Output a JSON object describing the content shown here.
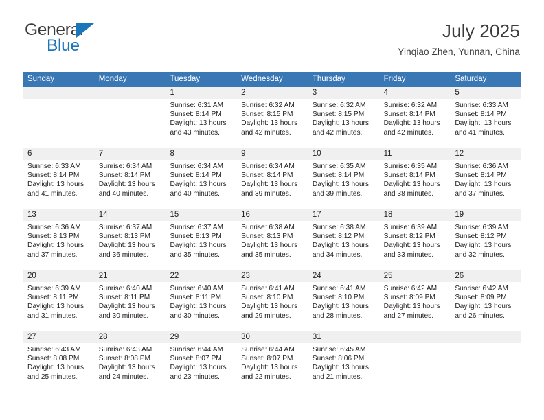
{
  "brand": {
    "name_top": "General",
    "name_bottom": "Blue",
    "color_primary": "#1b75bb",
    "color_text": "#3b3b3b",
    "triangle_icon": "triangle-icon"
  },
  "header": {
    "title": "July 2025",
    "subtitle": "Yinqiao Zhen, Yunnan, China"
  },
  "theme": {
    "header_bg": "#3a77b5",
    "header_text": "#ffffff",
    "daynum_bg": "#f0f0f0",
    "rule": "#3a77b5",
    "body_text": "#231f20"
  },
  "weekdays": [
    "Sunday",
    "Monday",
    "Tuesday",
    "Wednesday",
    "Thursday",
    "Friday",
    "Saturday"
  ],
  "labels": {
    "sunrise_prefix": "Sunrise:",
    "sunset_prefix": "Sunset:",
    "daylight_prefix": "Daylight:"
  },
  "weeks": [
    [
      {
        "day": "",
        "empty": true
      },
      {
        "day": "",
        "empty": true
      },
      {
        "day": "1",
        "sunrise": "Sunrise: 6:31 AM",
        "sunset": "Sunset: 8:14 PM",
        "daylight_l1": "Daylight: 13 hours",
        "daylight_l2": "and 43 minutes."
      },
      {
        "day": "2",
        "sunrise": "Sunrise: 6:32 AM",
        "sunset": "Sunset: 8:15 PM",
        "daylight_l1": "Daylight: 13 hours",
        "daylight_l2": "and 42 minutes."
      },
      {
        "day": "3",
        "sunrise": "Sunrise: 6:32 AM",
        "sunset": "Sunset: 8:15 PM",
        "daylight_l1": "Daylight: 13 hours",
        "daylight_l2": "and 42 minutes."
      },
      {
        "day": "4",
        "sunrise": "Sunrise: 6:32 AM",
        "sunset": "Sunset: 8:14 PM",
        "daylight_l1": "Daylight: 13 hours",
        "daylight_l2": "and 42 minutes."
      },
      {
        "day": "5",
        "sunrise": "Sunrise: 6:33 AM",
        "sunset": "Sunset: 8:14 PM",
        "daylight_l1": "Daylight: 13 hours",
        "daylight_l2": "and 41 minutes."
      }
    ],
    [
      {
        "day": "6",
        "sunrise": "Sunrise: 6:33 AM",
        "sunset": "Sunset: 8:14 PM",
        "daylight_l1": "Daylight: 13 hours",
        "daylight_l2": "and 41 minutes."
      },
      {
        "day": "7",
        "sunrise": "Sunrise: 6:34 AM",
        "sunset": "Sunset: 8:14 PM",
        "daylight_l1": "Daylight: 13 hours",
        "daylight_l2": "and 40 minutes."
      },
      {
        "day": "8",
        "sunrise": "Sunrise: 6:34 AM",
        "sunset": "Sunset: 8:14 PM",
        "daylight_l1": "Daylight: 13 hours",
        "daylight_l2": "and 40 minutes."
      },
      {
        "day": "9",
        "sunrise": "Sunrise: 6:34 AM",
        "sunset": "Sunset: 8:14 PM",
        "daylight_l1": "Daylight: 13 hours",
        "daylight_l2": "and 39 minutes."
      },
      {
        "day": "10",
        "sunrise": "Sunrise: 6:35 AM",
        "sunset": "Sunset: 8:14 PM",
        "daylight_l1": "Daylight: 13 hours",
        "daylight_l2": "and 39 minutes."
      },
      {
        "day": "11",
        "sunrise": "Sunrise: 6:35 AM",
        "sunset": "Sunset: 8:14 PM",
        "daylight_l1": "Daylight: 13 hours",
        "daylight_l2": "and 38 minutes."
      },
      {
        "day": "12",
        "sunrise": "Sunrise: 6:36 AM",
        "sunset": "Sunset: 8:14 PM",
        "daylight_l1": "Daylight: 13 hours",
        "daylight_l2": "and 37 minutes."
      }
    ],
    [
      {
        "day": "13",
        "sunrise": "Sunrise: 6:36 AM",
        "sunset": "Sunset: 8:13 PM",
        "daylight_l1": "Daylight: 13 hours",
        "daylight_l2": "and 37 minutes."
      },
      {
        "day": "14",
        "sunrise": "Sunrise: 6:37 AM",
        "sunset": "Sunset: 8:13 PM",
        "daylight_l1": "Daylight: 13 hours",
        "daylight_l2": "and 36 minutes."
      },
      {
        "day": "15",
        "sunrise": "Sunrise: 6:37 AM",
        "sunset": "Sunset: 8:13 PM",
        "daylight_l1": "Daylight: 13 hours",
        "daylight_l2": "and 35 minutes."
      },
      {
        "day": "16",
        "sunrise": "Sunrise: 6:38 AM",
        "sunset": "Sunset: 8:13 PM",
        "daylight_l1": "Daylight: 13 hours",
        "daylight_l2": "and 35 minutes."
      },
      {
        "day": "17",
        "sunrise": "Sunrise: 6:38 AM",
        "sunset": "Sunset: 8:12 PM",
        "daylight_l1": "Daylight: 13 hours",
        "daylight_l2": "and 34 minutes."
      },
      {
        "day": "18",
        "sunrise": "Sunrise: 6:39 AM",
        "sunset": "Sunset: 8:12 PM",
        "daylight_l1": "Daylight: 13 hours",
        "daylight_l2": "and 33 minutes."
      },
      {
        "day": "19",
        "sunrise": "Sunrise: 6:39 AM",
        "sunset": "Sunset: 8:12 PM",
        "daylight_l1": "Daylight: 13 hours",
        "daylight_l2": "and 32 minutes."
      }
    ],
    [
      {
        "day": "20",
        "sunrise": "Sunrise: 6:39 AM",
        "sunset": "Sunset: 8:11 PM",
        "daylight_l1": "Daylight: 13 hours",
        "daylight_l2": "and 31 minutes."
      },
      {
        "day": "21",
        "sunrise": "Sunrise: 6:40 AM",
        "sunset": "Sunset: 8:11 PM",
        "daylight_l1": "Daylight: 13 hours",
        "daylight_l2": "and 30 minutes."
      },
      {
        "day": "22",
        "sunrise": "Sunrise: 6:40 AM",
        "sunset": "Sunset: 8:11 PM",
        "daylight_l1": "Daylight: 13 hours",
        "daylight_l2": "and 30 minutes."
      },
      {
        "day": "23",
        "sunrise": "Sunrise: 6:41 AM",
        "sunset": "Sunset: 8:10 PM",
        "daylight_l1": "Daylight: 13 hours",
        "daylight_l2": "and 29 minutes."
      },
      {
        "day": "24",
        "sunrise": "Sunrise: 6:41 AM",
        "sunset": "Sunset: 8:10 PM",
        "daylight_l1": "Daylight: 13 hours",
        "daylight_l2": "and 28 minutes."
      },
      {
        "day": "25",
        "sunrise": "Sunrise: 6:42 AM",
        "sunset": "Sunset: 8:09 PM",
        "daylight_l1": "Daylight: 13 hours",
        "daylight_l2": "and 27 minutes."
      },
      {
        "day": "26",
        "sunrise": "Sunrise: 6:42 AM",
        "sunset": "Sunset: 8:09 PM",
        "daylight_l1": "Daylight: 13 hours",
        "daylight_l2": "and 26 minutes."
      }
    ],
    [
      {
        "day": "27",
        "sunrise": "Sunrise: 6:43 AM",
        "sunset": "Sunset: 8:08 PM",
        "daylight_l1": "Daylight: 13 hours",
        "daylight_l2": "and 25 minutes."
      },
      {
        "day": "28",
        "sunrise": "Sunrise: 6:43 AM",
        "sunset": "Sunset: 8:08 PM",
        "daylight_l1": "Daylight: 13 hours",
        "daylight_l2": "and 24 minutes."
      },
      {
        "day": "29",
        "sunrise": "Sunrise: 6:44 AM",
        "sunset": "Sunset: 8:07 PM",
        "daylight_l1": "Daylight: 13 hours",
        "daylight_l2": "and 23 minutes."
      },
      {
        "day": "30",
        "sunrise": "Sunrise: 6:44 AM",
        "sunset": "Sunset: 8:07 PM",
        "daylight_l1": "Daylight: 13 hours",
        "daylight_l2": "and 22 minutes."
      },
      {
        "day": "31",
        "sunrise": "Sunrise: 6:45 AM",
        "sunset": "Sunset: 8:06 PM",
        "daylight_l1": "Daylight: 13 hours",
        "daylight_l2": "and 21 minutes."
      },
      {
        "day": "",
        "empty": true
      },
      {
        "day": "",
        "empty": true
      }
    ]
  ]
}
